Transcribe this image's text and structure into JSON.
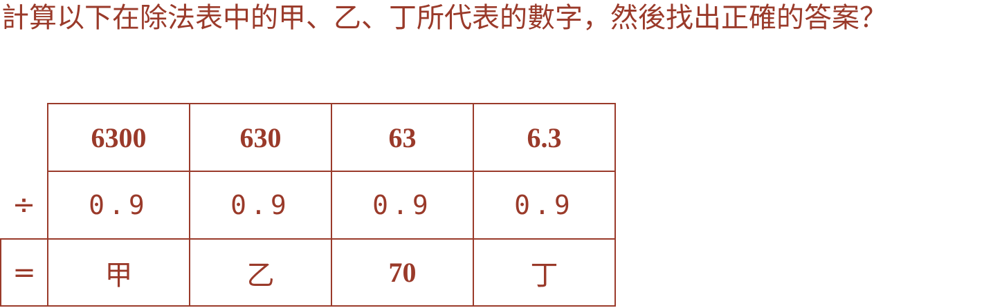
{
  "question": {
    "text": "計算以下在除法表中的甲、乙、丁所代表的數字，然後找出正確的答案？"
  },
  "table": {
    "divide_symbol": "÷",
    "equals_symbol": "=",
    "dividends": [
      "6300",
      "630",
      "63",
      "6.3"
    ],
    "divisors": [
      "0.9",
      "0.9",
      "0.9",
      "0.9"
    ],
    "results": [
      "甲",
      "乙",
      "70",
      "丁"
    ]
  },
  "colors": {
    "text": "#9a3a2a",
    "border": "#9a3a2a",
    "background": "#ffffff"
  }
}
